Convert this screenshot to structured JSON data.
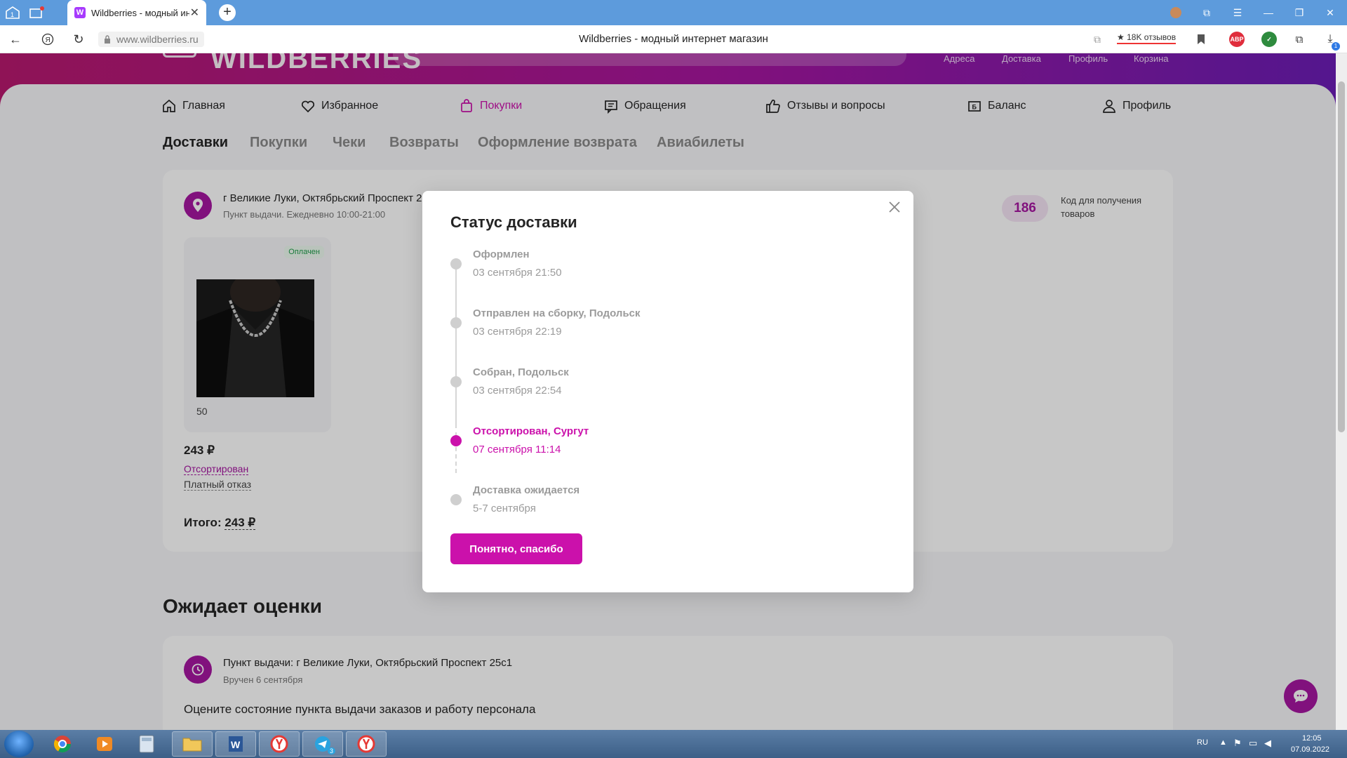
{
  "browser": {
    "tab_title": "Wildberries - модный ин",
    "new_tab": "+",
    "url": "www.wildberries.ru",
    "page_title": "Wildberries - модный интернет магазин",
    "reviews_badge": "★ 18K отзывов",
    "abp_label": "ABP",
    "download_count": "1"
  },
  "header": {
    "logo": "WILDBERRIES",
    "links": [
      "Адреса",
      "Доставка",
      "Профиль",
      "Корзина"
    ]
  },
  "top_nav": [
    {
      "label": "Главная",
      "icon": "home-icon"
    },
    {
      "label": "Избранное",
      "icon": "heart-icon"
    },
    {
      "label": "Покупки",
      "icon": "bag-icon",
      "active": true
    },
    {
      "label": "Обращения",
      "icon": "message-icon"
    },
    {
      "label": "Отзывы и вопросы",
      "icon": "thumb-up-icon"
    },
    {
      "label": "Баланс",
      "icon": "wallet-icon"
    },
    {
      "label": "Профиль",
      "icon": "user-icon"
    }
  ],
  "sub_tabs": [
    "Доставки",
    "Покупки",
    "Чеки",
    "Возвраты",
    "Оформление возврата",
    "Авиабилеты"
  ],
  "delivery": {
    "address": "г Великие Луки, Октябрьский Проспект 25с1",
    "schedule": "Пункт выдачи. Ежедневно 10:00-21:00",
    "code": "186",
    "code_label": "Код для получения товаров",
    "paid_badge": "Оплачен",
    "quantity": "50",
    "price": "243 ₽",
    "status": "Отсортирован",
    "paid_refusal": "Платный отказ",
    "total_label": "Итого:",
    "total_value": "243 ₽"
  },
  "rating_section": {
    "title": "Ожидает оценки",
    "address": "Пункт выдачи: г Великие Луки, Октябрьский Проспект 25с1",
    "delivered": "Вручен 6 сентября",
    "question": "Оцените состояние пункта выдачи заказов и работу персонала"
  },
  "modal": {
    "title": "Статус доставки",
    "steps": [
      {
        "title": "Оформлен",
        "date": "03 сентября 21:50",
        "active": false
      },
      {
        "title": "Отправлен на сборку, Подольск",
        "date": "03 сентября 22:19",
        "active": false
      },
      {
        "title": "Собран, Подольск",
        "date": "03 сентября 22:54",
        "active": false
      },
      {
        "title": "Отсортирован, Сургут",
        "date": "07 сентября 11:14",
        "active": true
      },
      {
        "title": "Доставка ожидается",
        "date": "5-7 сентября",
        "active": false
      }
    ],
    "confirm_button": "Понятно, спасибо"
  },
  "colors": {
    "accent": "#cb11ab",
    "brand_purple": "#a616a0",
    "header_gradient": [
      "#b8196f",
      "#a616a0",
      "#6c1db6"
    ]
  },
  "taskbar": {
    "language": "RU",
    "time": "12:05",
    "date": "07.09.2022",
    "telegram_badge": "3"
  }
}
